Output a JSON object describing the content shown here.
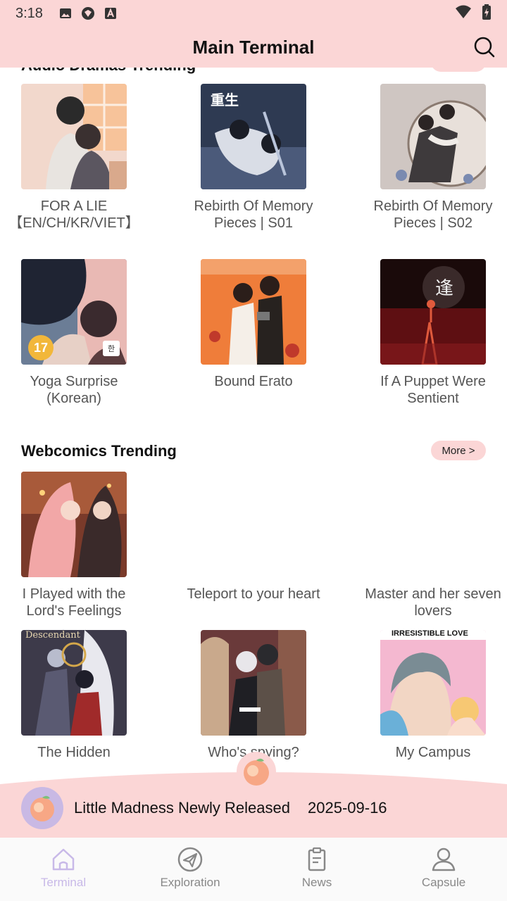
{
  "status_bar": {
    "time": "3:18"
  },
  "header": {
    "title": "Main Terminal"
  },
  "audio_section": {
    "title": "Audio Dramas Trending"
  },
  "audio_items": [
    {
      "title": "FOR A LIE 【EN/CH/KR/VIET】"
    },
    {
      "title": "Rebirth Of Memory  Pieces | S01"
    },
    {
      "title": "Rebirth Of Memory Pieces | S02"
    },
    {
      "title": "Yoga Surprise (Korean)",
      "badge_age": "17",
      "badge_lang": "한"
    },
    {
      "title": "Bound Erato"
    },
    {
      "title": "If A Puppet Were Sentient"
    }
  ],
  "webcomics_section": {
    "title": "Webcomics Trending",
    "more_label": "More >"
  },
  "webcomic_items": [
    {
      "title": "I Played with the Lord's Feelings"
    },
    {
      "title": "Teleport to your heart"
    },
    {
      "title": "Master and her seven lovers"
    },
    {
      "title": "The Hidden",
      "cover_text": "Descendant"
    },
    {
      "title": "Who's spying?"
    },
    {
      "title": "My Campus",
      "cover_text": "IRRESISTIBLE LOVE"
    }
  ],
  "banner": {
    "text": "Little Madness Newly Released",
    "date": "2025-09-16"
  },
  "tabs": [
    {
      "label": "Terminal",
      "icon": "home-icon"
    },
    {
      "label": "Exploration",
      "icon": "paper-plane-icon"
    },
    {
      "label": "News",
      "icon": "clipboard-icon"
    },
    {
      "label": "Capsule",
      "icon": "person-icon"
    }
  ],
  "colors": {
    "accent": "#fbd6d6",
    "active_tab": "#c8b9e8"
  }
}
